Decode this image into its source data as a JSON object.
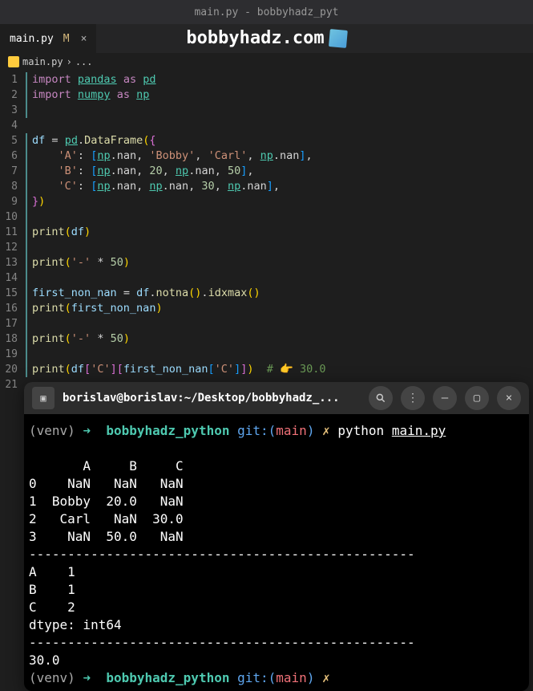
{
  "window": {
    "title": "main.py - bobbyhadz_pyt"
  },
  "watermark": {
    "text": "bobbyhadz.com"
  },
  "tab": {
    "name": "main.py",
    "modified": "M"
  },
  "breadcrumb": {
    "file": "main.py",
    "sep": "›",
    "more": "..."
  },
  "code": {
    "line1": {
      "import": "import",
      "mod": "pandas",
      "as": "as",
      "alias": "pd"
    },
    "line2": {
      "import": "import",
      "mod": "numpy",
      "as": "as",
      "alias": "np"
    },
    "line5": {
      "var": "df",
      "eq": "=",
      "pd": "pd",
      "dot": ".",
      "call": "DataFrame",
      "op": "(",
      "brace": "{"
    },
    "line6": {
      "key": "'A'",
      "colon": ":",
      "lb": "[",
      "np1": "np",
      "nan1": ".nan,",
      "s1": "'Bobby'",
      "c1": ",",
      "s2": "'Carl'",
      "c2": ",",
      "np2": "np",
      "nan2": ".nan",
      "rb": "]",
      "c3": ","
    },
    "line7": {
      "key": "'B'",
      "colon": ":",
      "lb": "[",
      "np1": "np",
      "nan1": ".nan,",
      "n1": "20",
      "c1": ",",
      "np2": "np",
      "nan2": ".nan,",
      "n2": "50",
      "rb": "]",
      "c2": ","
    },
    "line8": {
      "key": "'C'",
      "colon": ":",
      "lb": "[",
      "np1": "np",
      "nan1": ".nan,",
      "np2": "np",
      "nan2": ".nan,",
      "n1": "30",
      "c1": ",",
      "np3": "np",
      "nan3": ".nan",
      "rb": "]",
      "c2": ","
    },
    "line9": {
      "brace": "}",
      "paren": ")"
    },
    "line11": {
      "fn": "print",
      "lp": "(",
      "arg": "df",
      "rp": ")"
    },
    "line13": {
      "fn": "print",
      "lp": "(",
      "s": "'-'",
      "mul": "*",
      "n": "50",
      "rp": ")"
    },
    "line15": {
      "var": "first_non_nan",
      "eq": "=",
      "df": "df",
      "d1": ".",
      "notna": "notna",
      "p1": "(",
      "p2": ")",
      "d2": ".",
      "idxmax": "idxmax",
      "p3": "(",
      "p4": ")"
    },
    "line16": {
      "fn": "print",
      "lp": "(",
      "arg": "first_non_nan",
      "rp": ")"
    },
    "line18": {
      "fn": "print",
      "lp": "(",
      "s": "'-'",
      "mul": "*",
      "n": "50",
      "rp": ")"
    },
    "line20": {
      "fn": "print",
      "lp": "(",
      "df": "df",
      "lb1": "[",
      "s1": "'C'",
      "rb1": "]",
      "lb2": "[",
      "fn2": "first_non_nan",
      "lb3": "[",
      "s2": "'C'",
      "rb3": "]",
      "rb2": "]",
      "rp": ")",
      "comment": "# 👉️ 30.0"
    }
  },
  "terminal": {
    "title": "borislav@borislav:~/Desktop/bobbyhadz_...",
    "prompt": {
      "venv": "(venv)",
      "arrow": "➜",
      "dir": "bobbyhadz_python",
      "git": "git:",
      "lp": "(",
      "branch": "main",
      "rp": ")",
      "x": "✗",
      "cmd": "python",
      "file": "main.py"
    },
    "output": {
      "l1": "       A     B     C",
      "l2": "0    NaN   NaN   NaN",
      "l3": "1  Bobby  20.0   NaN",
      "l4": "2   Carl   NaN  30.0",
      "l5": "3    NaN  50.0   NaN",
      "l6": "--------------------------------------------------",
      "l7": "A    1",
      "l8": "B    1",
      "l9": "C    2",
      "l10": "dtype: int64",
      "l11": "--------------------------------------------------",
      "l12": "30.0"
    }
  }
}
